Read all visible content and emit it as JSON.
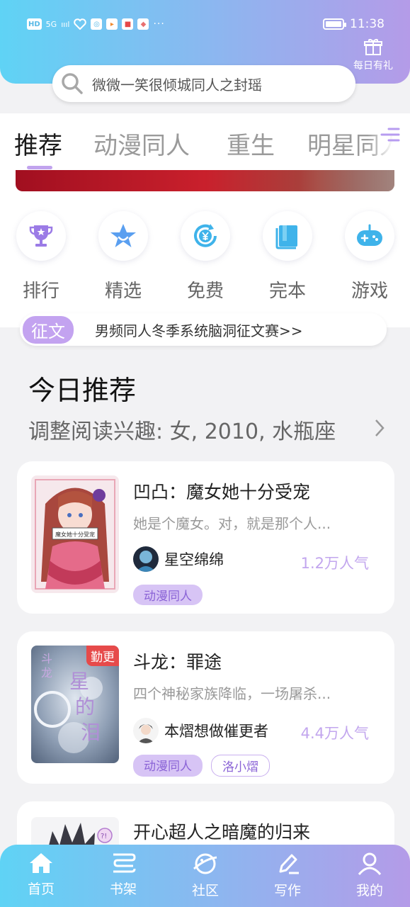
{
  "status_bar": {
    "hd": "HD",
    "net": "5G",
    "signal": "ıııl",
    "more": "···",
    "time": "11:38"
  },
  "header": {
    "daily_gift_label": "每日有礼",
    "search_placeholder": "微微一笑很倾城同人之封瑶"
  },
  "tabs": [
    "推荐",
    "动漫同人",
    "重生",
    "明星同人"
  ],
  "categories": [
    {
      "label": "排行",
      "icon": "trophy-icon"
    },
    {
      "label": "精选",
      "icon": "star-icon"
    },
    {
      "label": "免费",
      "icon": "yuan-cycle-icon"
    },
    {
      "label": "完本",
      "icon": "book-icon"
    },
    {
      "label": "游戏",
      "icon": "gamepad-icon"
    }
  ],
  "notice": {
    "tag": "征文",
    "text": "男频同人冬季系统脑洞征文赛>>"
  },
  "section": {
    "title": "今日推荐",
    "subtitle": "调整阅读兴趣: 女, 2010, 水瓶座"
  },
  "books": [
    {
      "title": "凹凸：魔女她十分受宠",
      "desc": "她是个魔女。对，就是那个人...",
      "author": "星空绵绵",
      "popularity": "1.2万人气",
      "tags": [
        "动漫同人"
      ],
      "cover_text": "魔女她十分受宠"
    },
    {
      "title": "斗龙：罪途",
      "desc": "四个神秘家族降临，一场屠杀...",
      "author": "本熠想做催更者",
      "popularity": "4.4万人气",
      "tags": [
        "动漫同人",
        "洛小熠"
      ],
      "badge": "勤更"
    },
    {
      "title": "开心超人之暗魔的归来"
    }
  ],
  "bottom_nav": [
    {
      "label": "首页",
      "icon": "home-icon"
    },
    {
      "label": "书架",
      "icon": "bookshelf-icon"
    },
    {
      "label": "社区",
      "icon": "planet-icon"
    },
    {
      "label": "写作",
      "icon": "pen-icon"
    },
    {
      "label": "我的",
      "icon": "user-icon"
    }
  ],
  "colors": {
    "accent": "#c3a3f0",
    "header_gradient_start": "#5fd3f5",
    "header_gradient_end": "#b49be8",
    "icon_blue": "#3fb3ea",
    "icon_purple": "#9b7be6"
  }
}
